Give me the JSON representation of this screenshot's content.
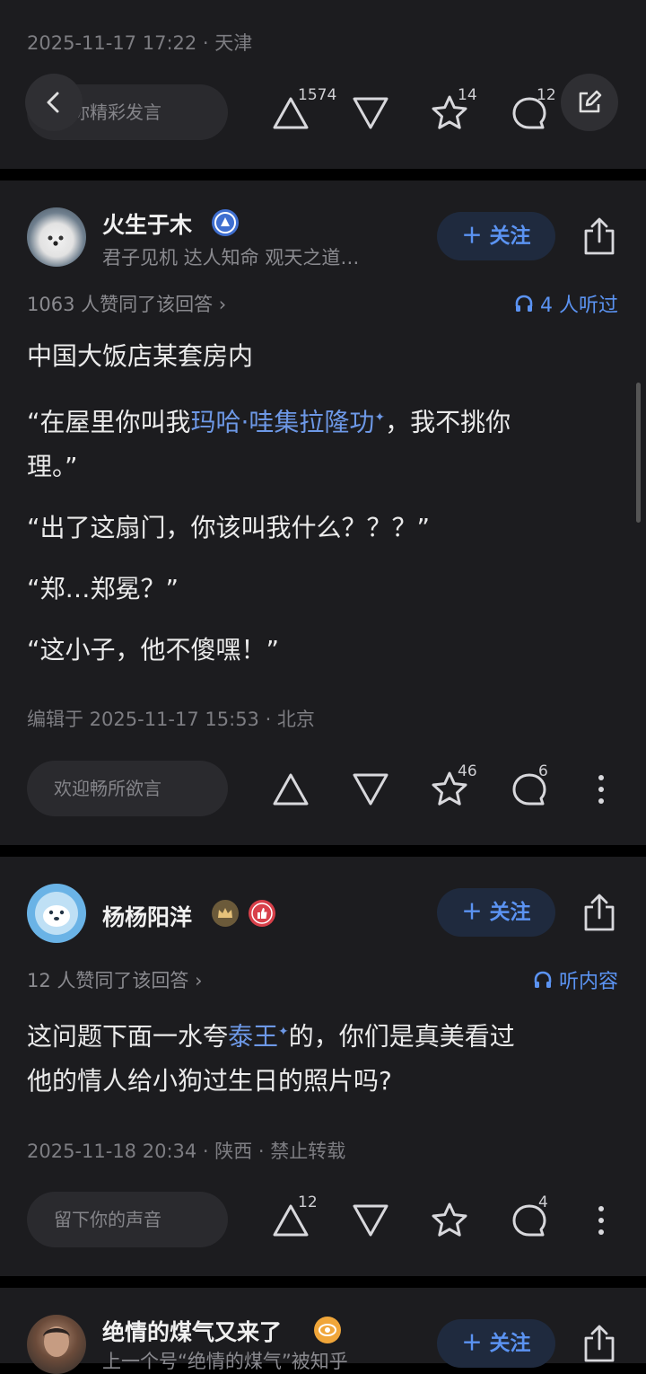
{
  "card0": {
    "meta": "2025-11-17 17:22 · 天津",
    "comment_placeholder": "说你精彩发言",
    "upvotes": "1574",
    "favorites": "14",
    "comments": "12"
  },
  "card1": {
    "author": "火生于木",
    "bio": "君子见机 达人知命 观天之道…",
    "follow_label": "关注",
    "agree_text": "1063 人赞同了该回答 ›",
    "listen_text": "4 人听过",
    "lines": {
      "l1": "中国大饭店某套房内",
      "l2_pre": "“在屋里你叫我",
      "l2_link": "玛哈·哇集拉隆功",
      "l2_post": "，我不挑你",
      "l2_cont": "理。”",
      "l3": "“出了这扇门，你该叫我什么？？？”",
      "l4": "“郑…郑冕？”",
      "l5": "“这小子，他不傻嘿！”"
    },
    "meta": "编辑于 2025-11-17 15:53 · 北京",
    "comment_placeholder": "欢迎畅所欲言",
    "favorites": "46",
    "comments": "6"
  },
  "card2": {
    "author": "杨杨阳洋",
    "follow_label": "关注",
    "agree_text": "12 人赞同了该回答 ›",
    "listen_text": "听内容",
    "line1_pre": "这问题下面一水夸",
    "line1_link": "泰王",
    "line1_post": "的，你们是真美看过",
    "line2": "他的情人给小狗过生日的照片吗?",
    "meta": "2025-11-18 20:34 · 陕西 · 禁止转载",
    "comment_placeholder": "留下你的声音",
    "upvotes": "12",
    "comments": "4"
  },
  "card3": {
    "author": "绝情的煤气又来了",
    "bio": "上一个号“绝情的煤气”被知乎",
    "follow_label": "关注"
  },
  "colors": {
    "accent": "#5b93f2",
    "background": "#000000",
    "card": "#1c1c1f"
  }
}
